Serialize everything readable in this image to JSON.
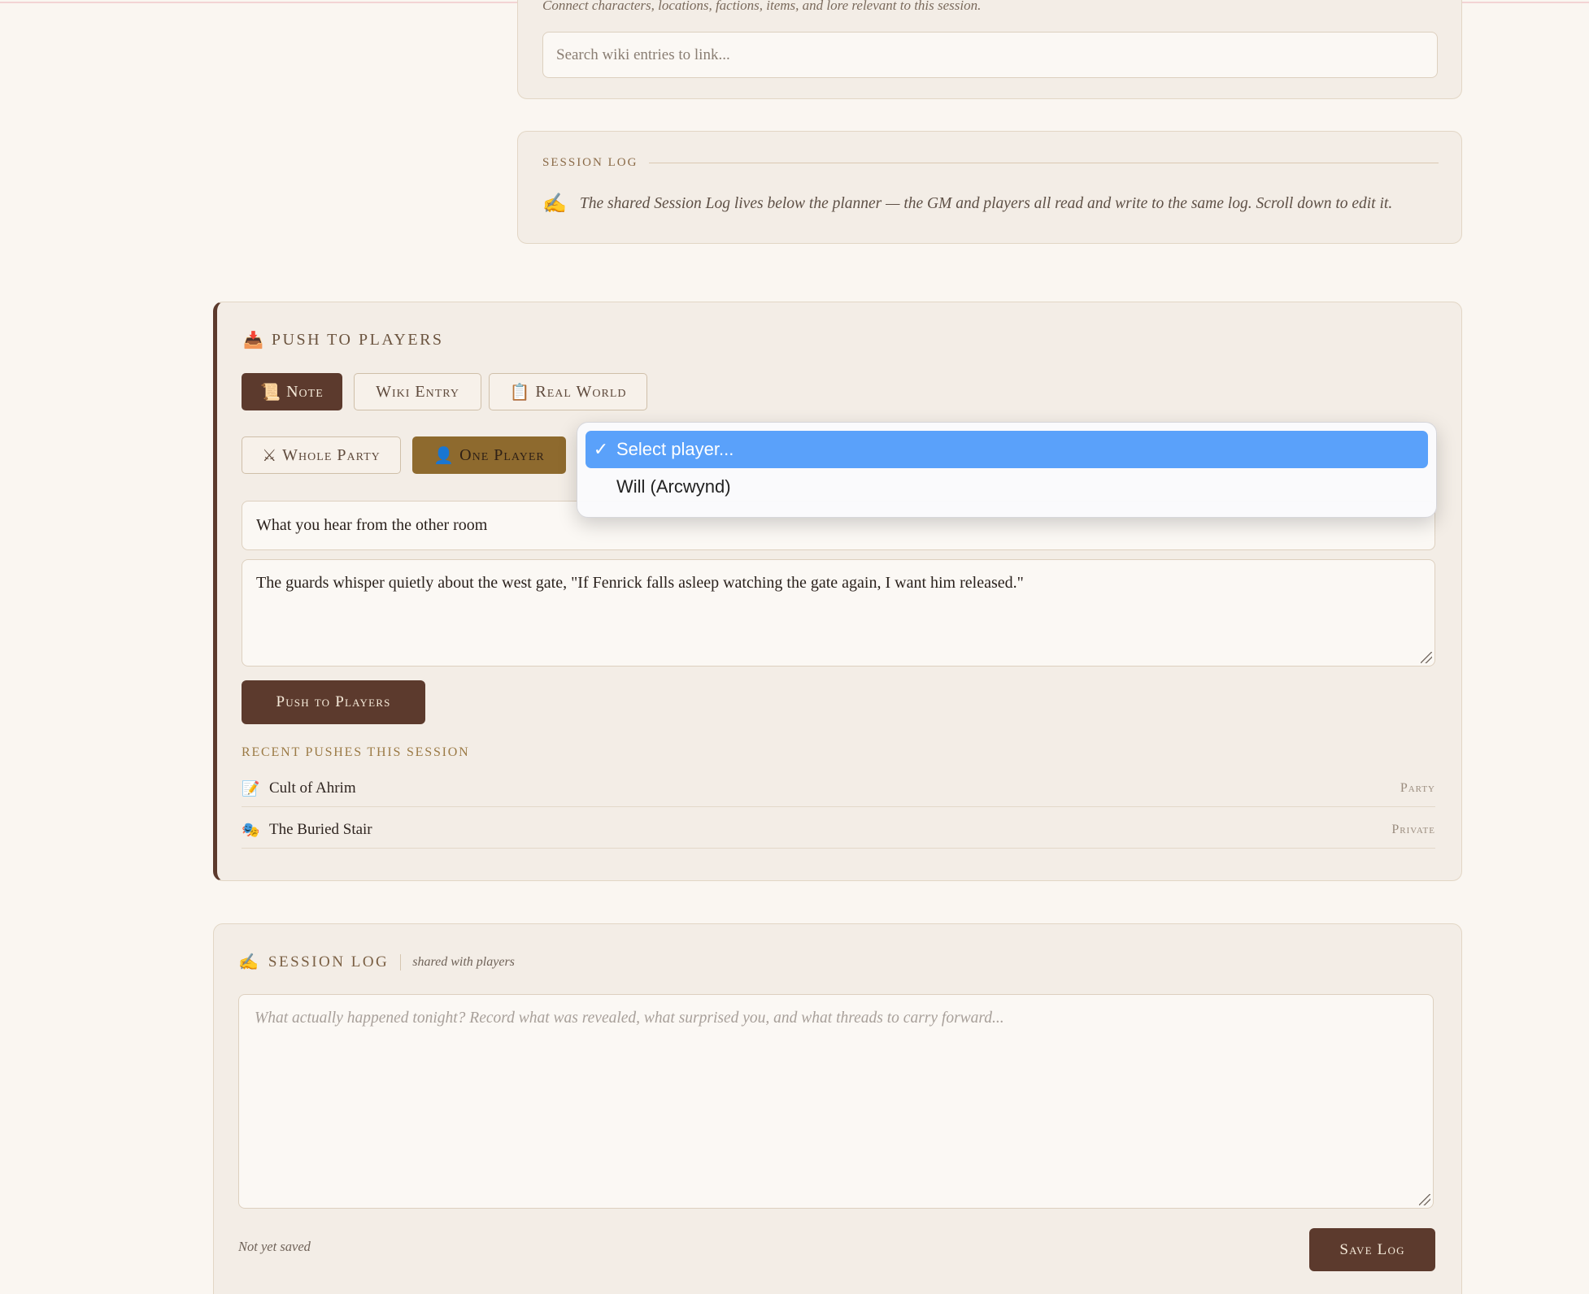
{
  "wiki_link": {
    "hint": "Connect characters, locations, factions, items, and lore relevant to this session.",
    "search_placeholder": "Search wiki entries to link..."
  },
  "session_note": {
    "heading": "Session Log",
    "icon": "writing-hand-icon",
    "text": "The shared Session Log lives below the planner — the GM and players all read and write to the same log. Scroll down to edit it."
  },
  "push": {
    "title": "Push to Players",
    "title_icon": "inbox-tray-icon",
    "tabs": [
      {
        "label": "Note",
        "icon": "scroll-icon",
        "glyph": "📜",
        "active": true
      },
      {
        "label": "Wiki Entry",
        "icon": "",
        "glyph": "",
        "active": false
      },
      {
        "label": "Real World",
        "icon": "notepad-icon",
        "glyph": "📋",
        "active": false
      }
    ],
    "audience": [
      {
        "label": "Whole Party",
        "icon": "crossed-swords-icon",
        "glyph": "⚔",
        "active": false
      },
      {
        "label": "One Player",
        "icon": "bust-silhouette-icon",
        "glyph": "👤",
        "active": true
      }
    ],
    "player_select": {
      "options": [
        "Select player...",
        "Will (Arcwynd)"
      ],
      "selected": "Select player..."
    },
    "title_value": "What you hear from the other room",
    "body_value": "The guards whisper quietly about the west gate, \"If Fenrick falls asleep watching the gate again, I want him released.\"",
    "button": "Push to Players",
    "recent_heading": "Recent Pushes This Session",
    "recent": [
      {
        "icon": "memo-icon",
        "glyph": "📝",
        "name": "Cult of Ahrim",
        "scope": "Party"
      },
      {
        "icon": "masks-icon",
        "glyph": "🎭",
        "name": "The Buried Stair",
        "scope": "Private"
      }
    ]
  },
  "session_log": {
    "icon": "writing-hand-icon",
    "title": "Session Log",
    "subtitle": "shared with players",
    "placeholder": "What actually happened tonight? Record what was revealed, what surprised you, and what threads to carry forward...",
    "status": "Not yet saved",
    "save_button": "Save Log"
  },
  "colors": {
    "page_bg": "#faf6f1",
    "card_bg": "#f3ede6",
    "accent_dark": "#5c3a2d",
    "accent_gold": "#8e6a2e",
    "select_blue": "#5aa1fa"
  }
}
